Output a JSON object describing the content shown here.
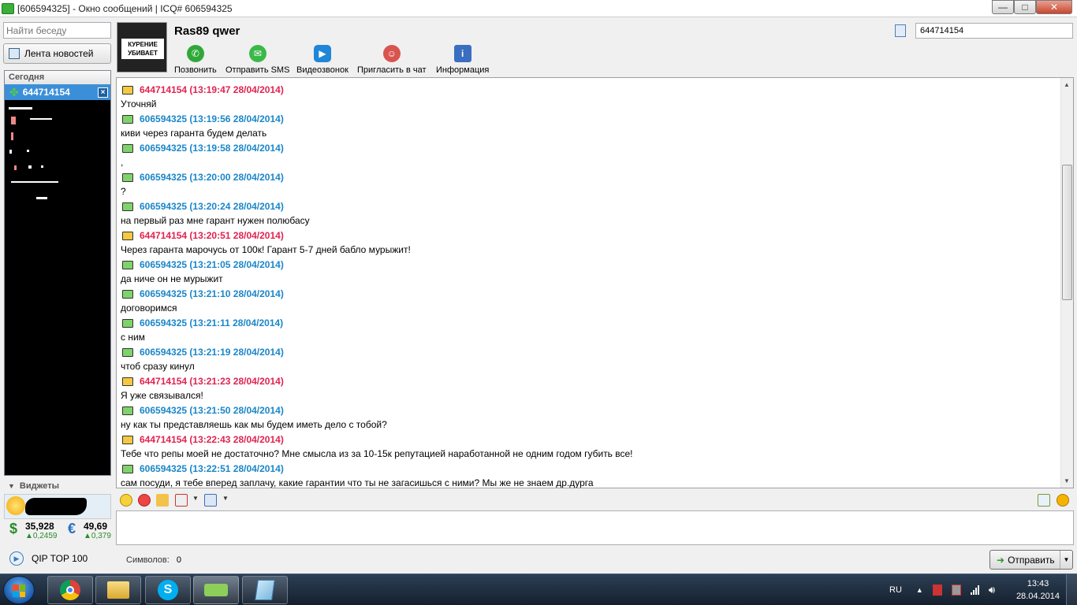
{
  "window": {
    "title": "[606594325] - Окно сообщений | ICQ# 606594325",
    "minimize": "—",
    "maximize": "□",
    "close": "✕"
  },
  "sidebar": {
    "search_placeholder": "Найти беседу",
    "news_label": "Лента новостей",
    "today_label": "Сегодня",
    "active_contact": "644714154",
    "widgets_label": "Виджеты",
    "currency": [
      {
        "symbol": "$",
        "value": "35,928",
        "change": "▲0,2459"
      },
      {
        "symbol": "€",
        "value": "49,69",
        "change": "▲0,379"
      }
    ],
    "qip_top": "QIP TOP 100"
  },
  "header": {
    "contact_name": "Ras89 qwer",
    "avatar_text": "КУРЕНИЕ УБИВАЕТ",
    "uin_value": "644714154",
    "tools": [
      {
        "label": "Позвонить",
        "icon": "phone-icon",
        "color": "#2fa83a",
        "glyph": "✆"
      },
      {
        "label": "Отправить SMS",
        "icon": "sms-icon",
        "color": "#3cb84a",
        "glyph": "✉"
      },
      {
        "label": "Видеозвонок",
        "icon": "video-icon",
        "color": "#1f86d8",
        "glyph": "▶"
      },
      {
        "label": "Пригласить в чат",
        "icon": "invite-icon",
        "color": "#d9534f",
        "glyph": "☺"
      },
      {
        "label": "Информация",
        "icon": "info-icon",
        "color": "#3a6ec0",
        "glyph": "i"
      }
    ]
  },
  "messages": [
    {
      "author": "them",
      "header": "644714154 (13:19:47 28/04/2014)",
      "text": "Уточняй"
    },
    {
      "author": "me",
      "header": "606594325 (13:19:56 28/04/2014)",
      "text": "киви через гаранта будем делать"
    },
    {
      "author": "me",
      "header": "606594325 (13:19:58 28/04/2014)",
      "text": ","
    },
    {
      "author": "me",
      "header": "606594325 (13:20:00 28/04/2014)",
      "text": "?"
    },
    {
      "author": "me",
      "header": "606594325 (13:20:24 28/04/2014)",
      "text": "на первый раз мне гарант нужен полюбасу"
    },
    {
      "author": "them",
      "header": "644714154 (13:20:51 28/04/2014)",
      "text": "Через гаранта марочусь от 100к! Гарант 5-7 дней бабло мурыжит!"
    },
    {
      "author": "me",
      "header": "606594325 (13:21:05 28/04/2014)",
      "text": "да ниче он не мурыжит"
    },
    {
      "author": "me",
      "header": "606594325 (13:21:10 28/04/2014)",
      "text": "договоримся"
    },
    {
      "author": "me",
      "header": "606594325 (13:21:11 28/04/2014)",
      "text": "с ним"
    },
    {
      "author": "me",
      "header": "606594325 (13:21:19 28/04/2014)",
      "text": "чтоб сразу кинул"
    },
    {
      "author": "them",
      "header": "644714154 (13:21:23 28/04/2014)",
      "text": "Я уже связывался!"
    },
    {
      "author": "me",
      "header": "606594325 (13:21:50 28/04/2014)",
      "text": "ну как ты представляешь как мы будем иметь дело с тобой?"
    },
    {
      "author": "them",
      "header": "644714154 (13:22:43 28/04/2014)",
      "text": "Тебе что репы моей не достаточно? Мне смысла из за 10-15к репутацией наработанной не одним годом губить все!"
    },
    {
      "author": "me",
      "header": "606594325 (13:22:51 28/04/2014)",
      "text": "сам посуди, я тебе вперед заплачу, какие гарантии что ты не загасишься с ними? Мы же не знаем др.дурга"
    }
  ],
  "footer": {
    "chars_label": "Символов:",
    "chars_value": "0",
    "send_label": "Отправить"
  },
  "taskbar": {
    "lang": "RU",
    "time": "13:43",
    "date": "28.04.2014"
  },
  "colors": {
    "them_header": "#e0234f",
    "me_header": "#1a86c8",
    "selected_contact": "#3b8fd8"
  }
}
